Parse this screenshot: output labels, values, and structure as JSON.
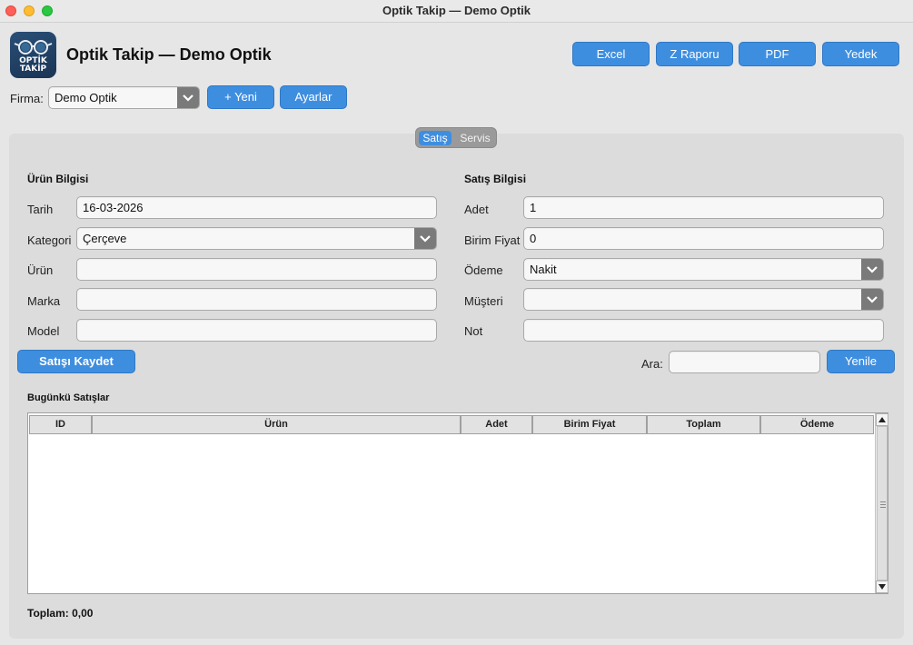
{
  "window": {
    "title": "Optik Takip — Demo Optik"
  },
  "header": {
    "logo_line1": "OPTİK",
    "logo_line2": "TAKİP",
    "title": "Optik Takip — Demo Optik",
    "buttons": {
      "excel": "Excel",
      "z_raporu": "Z Raporu",
      "pdf": "PDF",
      "yedek": "Yedek"
    }
  },
  "firma": {
    "label": "Firma:",
    "selected": "Demo Optik",
    "new_button": "+ Yeni",
    "settings_button": "Ayarlar"
  },
  "tabs": [
    {
      "label": "Satış",
      "active": true
    },
    {
      "label": "Servis",
      "active": false
    }
  ],
  "urun_bilgisi": {
    "title": "Ürün Bilgisi",
    "tarih_label": "Tarih",
    "tarih_value": "16-03-2026",
    "kategori_label": "Kategori",
    "kategori_value": "Çerçeve",
    "urun_label": "Ürün",
    "urun_value": "",
    "marka_label": "Marka",
    "marka_value": "",
    "model_label": "Model",
    "model_value": ""
  },
  "satis_bilgisi": {
    "title": "Satış Bilgisi",
    "adet_label": "Adet",
    "adet_value": "1",
    "birim_fiyat_label": "Birim Fiyat",
    "birim_fiyat_value": "0",
    "odeme_label": "Ödeme",
    "odeme_value": "Nakit",
    "musteri_label": "Müşteri",
    "musteri_value": "",
    "not_label": "Not",
    "not_value": ""
  },
  "actions": {
    "save": "Satışı Kaydet",
    "search_label": "Ara:",
    "search_value": "",
    "refresh": "Yenile"
  },
  "sales_table": {
    "title": "Bugünkü Satışlar",
    "columns": [
      "ID",
      "Ürün",
      "Adet",
      "Birim Fiyat",
      "Toplam",
      "Ödeme"
    ],
    "rows": []
  },
  "footer": {
    "total": "Toplam: 0,00"
  },
  "colors": {
    "accent": "#3e8ee0",
    "panel": "#dcdcdc",
    "background": "#e6e6e6"
  }
}
